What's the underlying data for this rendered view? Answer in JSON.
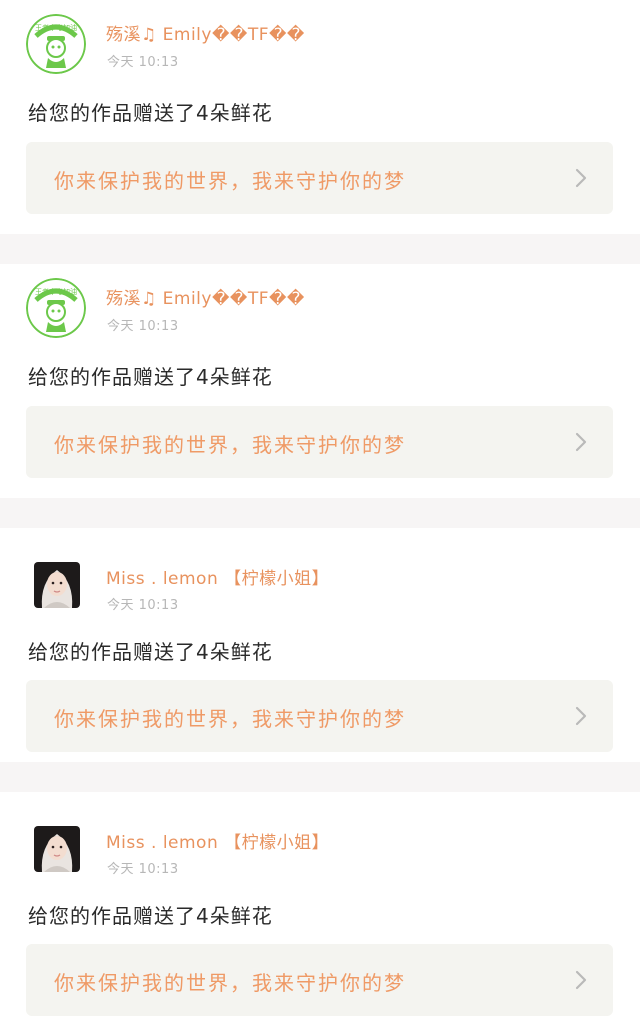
{
  "feed": {
    "items": [
      {
        "username": "殇溪♫ Emily��TF��",
        "timestamp": "今天 10:13",
        "action": "给您的作品赠送了4朵鲜花",
        "quote": "你来保护我的世界，我来守护你的梦",
        "avatar_badge": "王者中考加油",
        "avatar_icon": "green-cartoon-badge-avatar"
      },
      {
        "username": "殇溪♫ Emily��TF��",
        "timestamp": "今天 10:13",
        "action": "给您的作品赠送了4朵鲜花",
        "quote": "你来保护我的世界，我来守护你的梦",
        "avatar_badge": "王者中考加油",
        "avatar_icon": "green-cartoon-badge-avatar"
      },
      {
        "username": "Miss . lemon 【柠檬小姐】",
        "timestamp": "今天 10:13",
        "action": "给您的作品赠送了4朵鲜花",
        "quote": "你来保护我的世界，我来守护你的梦",
        "avatar_icon": "girl-portrait-avatar"
      },
      {
        "username": "Miss . lemon 【柠檬小姐】",
        "timestamp": "今天 10:13",
        "action": "给您的作品赠送了4朵鲜花",
        "quote": "你来保护我的世界，我来守护你的梦",
        "avatar_icon": "girl-portrait-avatar"
      }
    ]
  },
  "colors": {
    "username": "#e8925e",
    "quote": "#ef9a66",
    "timestamp": "#b7b7b7",
    "action_text": "#2a2a2a",
    "quote_box_bg": "#f4f4f0",
    "divider": "#f7f5f5",
    "avatar_green": "#6cc84a"
  }
}
